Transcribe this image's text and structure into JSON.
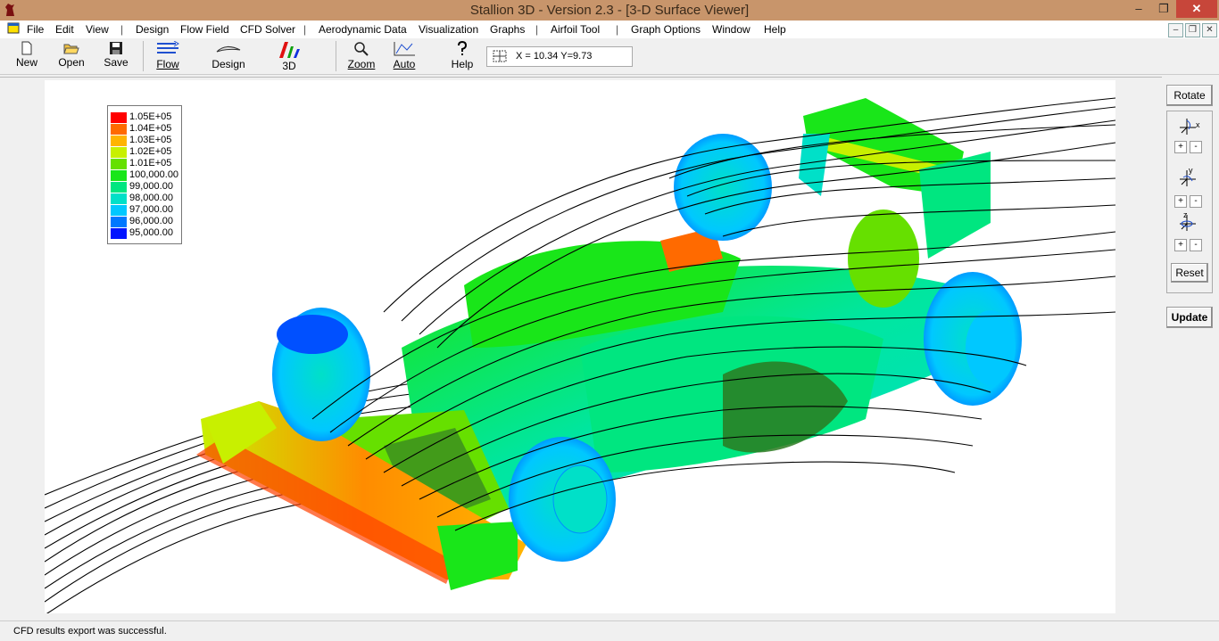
{
  "window": {
    "title": "Stallion 3D - Version 2.3 - [3-D Surface Viewer]",
    "controls": {
      "minimize": "–",
      "maximize": "❐",
      "close": "✕"
    }
  },
  "menu": {
    "items": [
      "File",
      "Edit",
      "View",
      "Design",
      "Flow Field",
      "CFD Solver",
      "Aerodynamic Data",
      "Visualization",
      "Graphs",
      "Airfoil Tool",
      "Graph Options",
      "Window",
      "Help"
    ],
    "mdi_controls": {
      "minimize": "–",
      "restore": "❐",
      "close": "✕"
    }
  },
  "toolbar": {
    "new": "New",
    "open": "Open",
    "save": "Save",
    "flow": "Flow",
    "design": "Design",
    "three_d": "3D",
    "zoom": "Zoom",
    "auto": "Auto",
    "help": "Help",
    "coordinates": "X = 10.34  Y=9.73"
  },
  "legend": {
    "entries": [
      {
        "label": "1.05E+05",
        "color": "#ff0000"
      },
      {
        "label": "1.04E+05",
        "color": "#ff6a00"
      },
      {
        "label": "1.03E+05",
        "color": "#ffb400"
      },
      {
        "label": "1.02E+05",
        "color": "#c8f000"
      },
      {
        "label": "1.01E+05",
        "color": "#66e000"
      },
      {
        "label": "100,000.00",
        "color": "#19e619"
      },
      {
        "label": "99,000.00",
        "color": "#00e680"
      },
      {
        "label": "98,000.00",
        "color": "#00e0c8"
      },
      {
        "label": "97,000.00",
        "color": "#00c8ff"
      },
      {
        "label": "96,000.00",
        "color": "#0078ff"
      },
      {
        "label": "95,000.00",
        "color": "#0014ff"
      }
    ]
  },
  "side_panel": {
    "rotate": "Rotate",
    "x_axis": "x",
    "y_axis": "y",
    "z_axis": "z",
    "plus": "+",
    "minus": "-",
    "reset": "Reset",
    "update": "Update"
  },
  "status": {
    "message": "CFD results export was successful."
  }
}
